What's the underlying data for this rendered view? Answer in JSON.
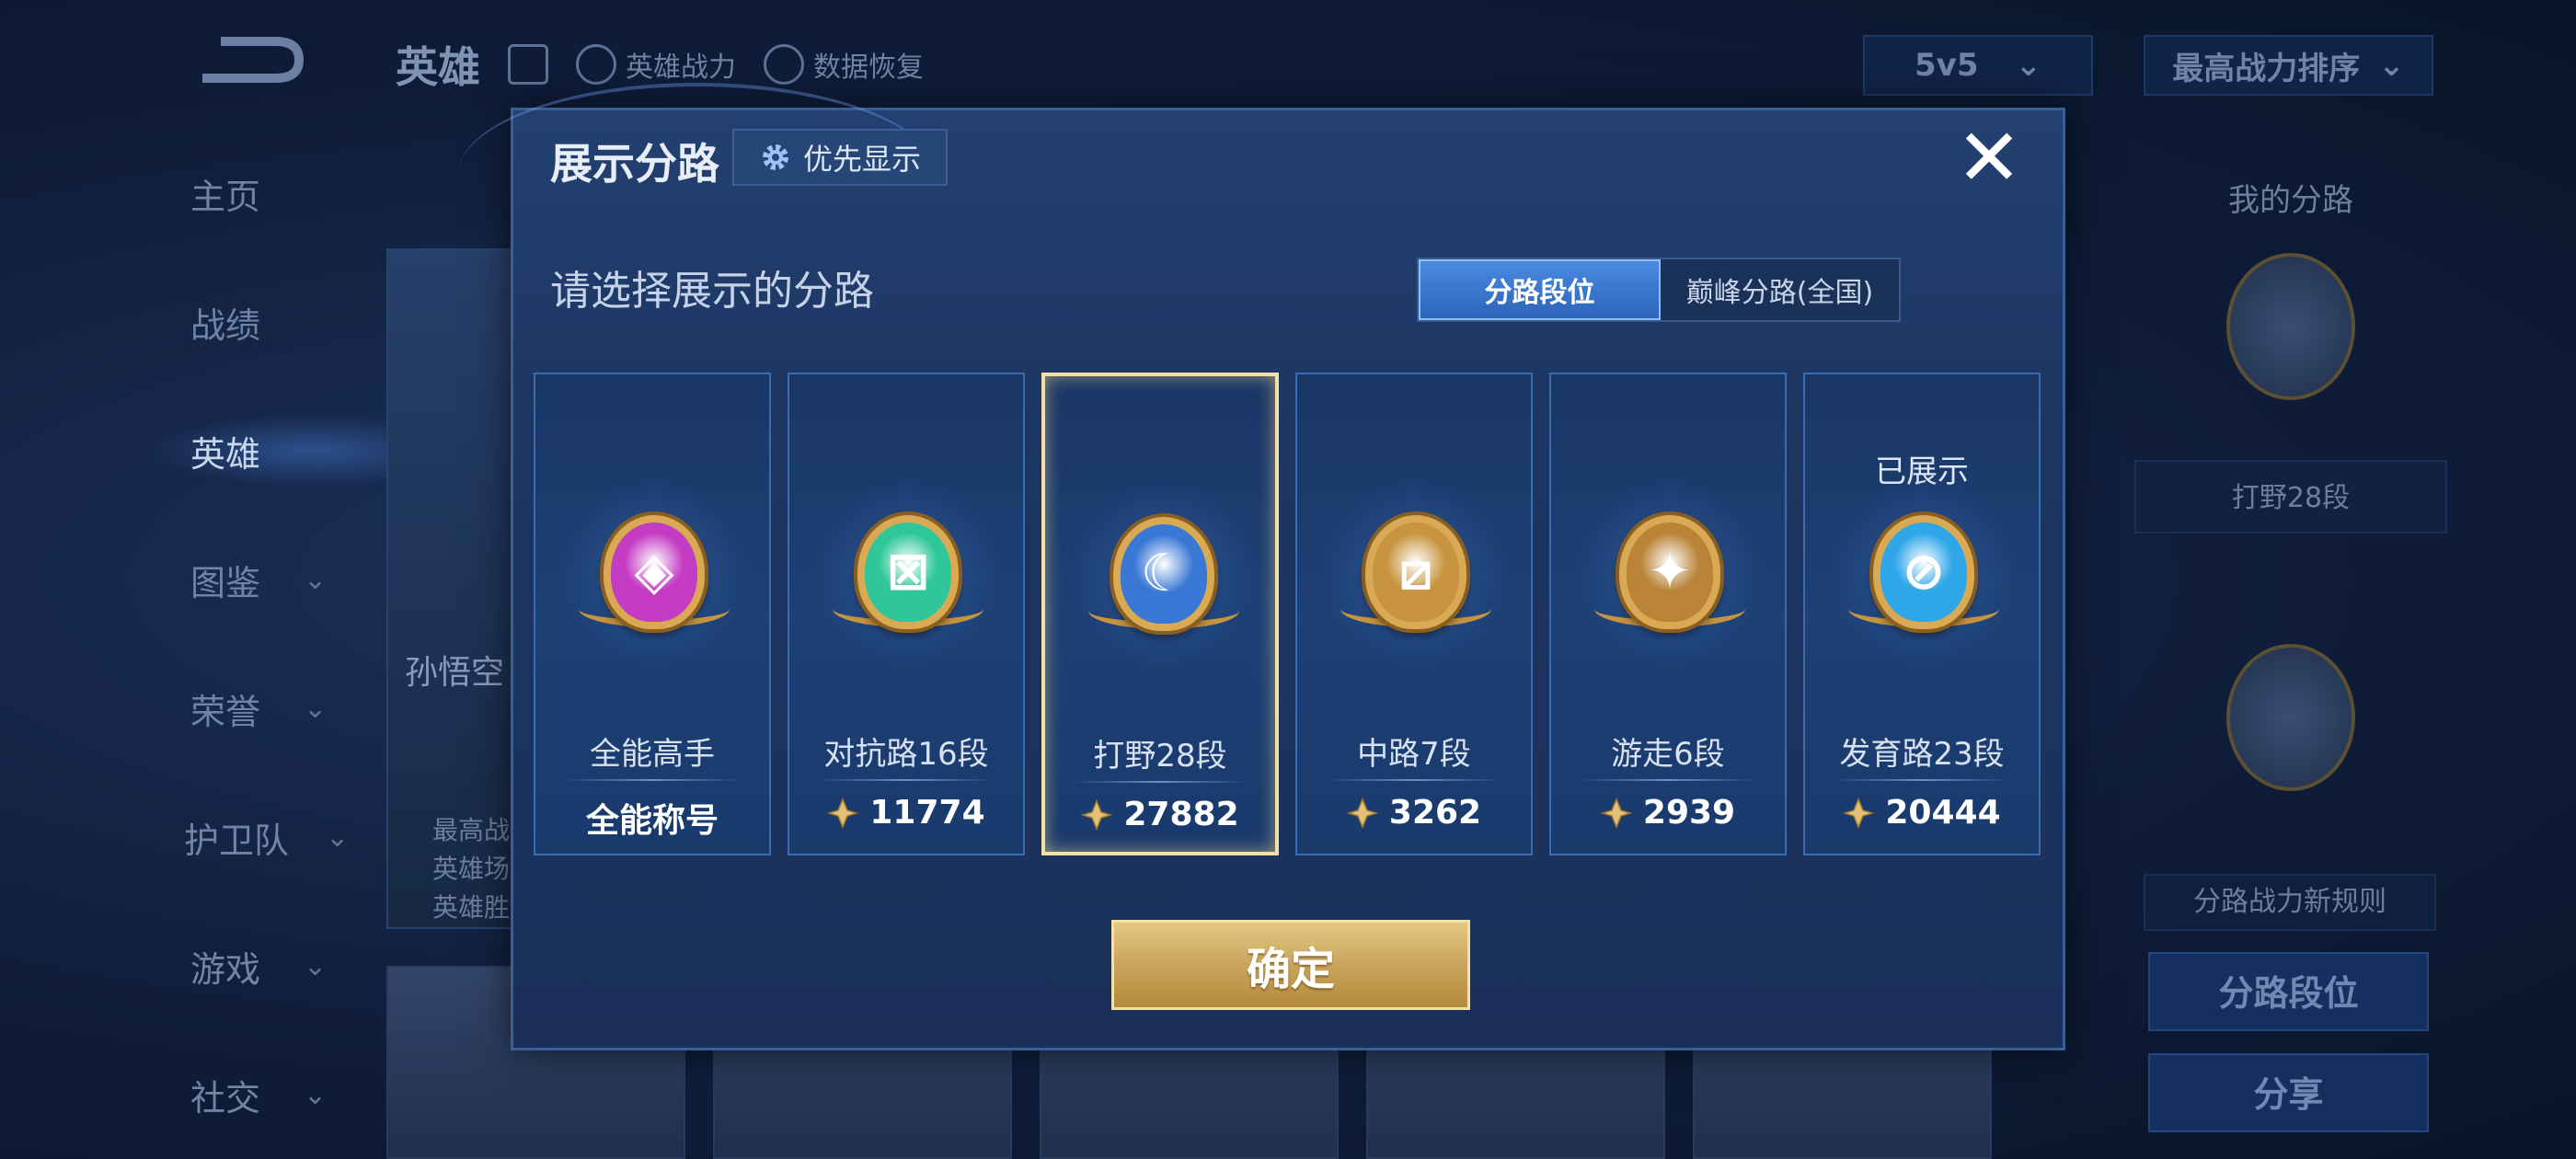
{
  "background": {
    "topbar": {
      "title": "英雄",
      "hero_power": "英雄战力",
      "data_restore": "数据恢复",
      "mode": "5v5",
      "sort": "最高战力排序"
    },
    "sidebar": {
      "items": [
        {
          "label": "主页",
          "chevron": false
        },
        {
          "label": "战绩",
          "chevron": false
        },
        {
          "label": "英雄",
          "chevron": false,
          "active": true
        },
        {
          "label": "图鉴",
          "chevron": true
        },
        {
          "label": "荣誉",
          "chevron": true
        },
        {
          "label": "护卫队",
          "chevron": true
        },
        {
          "label": "游戏",
          "chevron": true
        },
        {
          "label": "社交",
          "chevron": true
        }
      ]
    },
    "hero_card": {
      "name": "孙悟空",
      "stat_lines": [
        "最高战",
        "英雄场",
        "英雄胜"
      ]
    },
    "right_panel": {
      "title": "我的分路",
      "current_lane": "打野28段",
      "rule": "分路战力新规则",
      "lane_rank_button": "分路段位",
      "share_button": "分享"
    }
  },
  "modal": {
    "title": "展示分路",
    "priority_button": "优先显示",
    "subtitle": "请选择展示的分路",
    "toggle": {
      "options": [
        "分路段位",
        "巅峰分路(全国)"
      ],
      "selected": 0
    },
    "cards": [
      {
        "rank": "全能高手",
        "score": "全能称号",
        "has_power_icon": false,
        "shown_label": "",
        "medal_color": "#c43cc4",
        "medal_icon": "allround-icon",
        "selected": false
      },
      {
        "rank": "对抗路16段",
        "score": "11774",
        "has_power_icon": true,
        "shown_label": "",
        "medal_color": "#2fc79a",
        "medal_icon": "clash-lane-icon",
        "selected": false
      },
      {
        "rank": "打野28段",
        "score": "27882",
        "has_power_icon": true,
        "shown_label": "",
        "medal_color": "#3a78d6",
        "medal_icon": "jungle-dragon-icon",
        "selected": true
      },
      {
        "rank": "中路7段",
        "score": "3262",
        "has_power_icon": true,
        "shown_label": "",
        "medal_color": "#c8943f",
        "medal_icon": "mid-lane-icon",
        "selected": false
      },
      {
        "rank": "游走6段",
        "score": "2939",
        "has_power_icon": true,
        "shown_label": "",
        "medal_color": "#b98338",
        "medal_icon": "roam-wing-icon",
        "selected": false
      },
      {
        "rank": "发育路23段",
        "score": "20444",
        "has_power_icon": true,
        "shown_label": "已展示",
        "medal_color": "#2fa6e8",
        "medal_icon": "farm-lane-icon",
        "selected": false
      }
    ],
    "confirm_button": "确定"
  },
  "colors": {
    "modal_bg": "#1c3561",
    "card_border": "#3b6cb0",
    "selected_border": "#f3dfa8",
    "confirm_gold": "#c9a45c",
    "toggle_active": "#2c64b9"
  }
}
